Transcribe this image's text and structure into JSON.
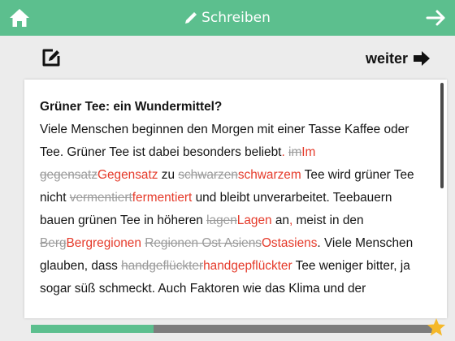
{
  "header": {
    "title": "Schreiben",
    "accent_color": "#5cbf8e",
    "home_icon": "home-icon",
    "next_icon": "arrow-right-icon",
    "title_icon": "pencil-icon"
  },
  "toolbar": {
    "edit_icon": "edit-note-icon",
    "next_label": "weiter",
    "next_icon": "arrow-right-solid-icon"
  },
  "text": {
    "title": "Grüner Tee: ein Wundermittel?",
    "segments": [
      {
        "t": "Viele Menschen beginnen den Morgen mit einer Tasse Kaffee oder Tee. Grüner Tee ist dabei besonders beliebt",
        "s": "n"
      },
      {
        "t": ".",
        "s": "ins"
      },
      {
        "t": " ",
        "s": "n"
      },
      {
        "t": "im",
        "s": "del"
      },
      {
        "t": "Im",
        "s": "ins"
      },
      {
        "t": " ",
        "s": "n"
      },
      {
        "t": "gegensatz",
        "s": "del"
      },
      {
        "t": "Gegensatz",
        "s": "ins"
      },
      {
        "t": " zu ",
        "s": "n"
      },
      {
        "t": "schwarzen",
        "s": "del"
      },
      {
        "t": "schwarzem",
        "s": "ins"
      },
      {
        "t": " Tee wird grüner Tee nicht ",
        "s": "n"
      },
      {
        "t": "vermentiert",
        "s": "del"
      },
      {
        "t": "fermentiert",
        "s": "ins"
      },
      {
        "t": " und bleibt unverarbeitet. Teebauern bauen grünen Tee in höheren ",
        "s": "n"
      },
      {
        "t": "lagen",
        "s": "del"
      },
      {
        "t": "Lagen",
        "s": "ins"
      },
      {
        "t": " an",
        "s": "n"
      },
      {
        "t": ",",
        "s": "ins"
      },
      {
        "t": " meist in den ",
        "s": "n"
      },
      {
        "t": "Berg",
        "s": "del"
      },
      {
        "t": "Bergregionen",
        "s": "ins"
      },
      {
        "t": " ",
        "s": "n"
      },
      {
        "t": "Regionen Ost Asiens",
        "s": "del"
      },
      {
        "t": "Ostasiens",
        "s": "ins"
      },
      {
        "t": ". Viele Menschen glauben, dass ",
        "s": "n"
      },
      {
        "t": "handgeflückter",
        "s": "del"
      },
      {
        "t": "handgepflückter",
        "s": "ins"
      },
      {
        "t": " Tee weniger bitter, ja sogar süß schmeckt. Auch Faktoren wie das Klima und der",
        "s": "n"
      }
    ]
  },
  "progress": {
    "value": 0.305,
    "fill_color": "#5cbf8e",
    "track_color": "#7d7d7d",
    "star_icon": "star-icon",
    "star_color": "#f5b829"
  }
}
